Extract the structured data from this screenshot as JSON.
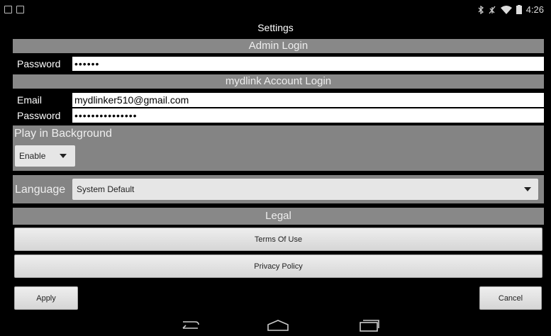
{
  "status": {
    "time": "4:26"
  },
  "page": {
    "title": "Settings"
  },
  "admin": {
    "header": "Admin Login",
    "password_label": "Password",
    "password_value": "••••••"
  },
  "mydlink": {
    "header": "mydlink Account Login",
    "email_label": "Email",
    "email_value": "mydlinker510@gmail.com",
    "password_label": "Password",
    "password_value": "•••••••••••••••"
  },
  "background": {
    "label": "Play in Background",
    "selected": "Enable"
  },
  "language": {
    "label": "Language",
    "selected": "System Default"
  },
  "legal": {
    "header": "Legal",
    "terms_label": "Terms Of Use",
    "privacy_label": "Privacy Policy"
  },
  "actions": {
    "apply_label": "Apply",
    "cancel_label": "Cancel"
  },
  "icons": {
    "status_left": [
      "image-icon",
      "clipboard-icon"
    ],
    "status_right": [
      "bluetooth-icon",
      "no-signal-icon",
      "wifi-icon",
      "battery-icon"
    ],
    "nav": [
      "back-icon",
      "home-icon",
      "recent-apps-icon"
    ]
  }
}
